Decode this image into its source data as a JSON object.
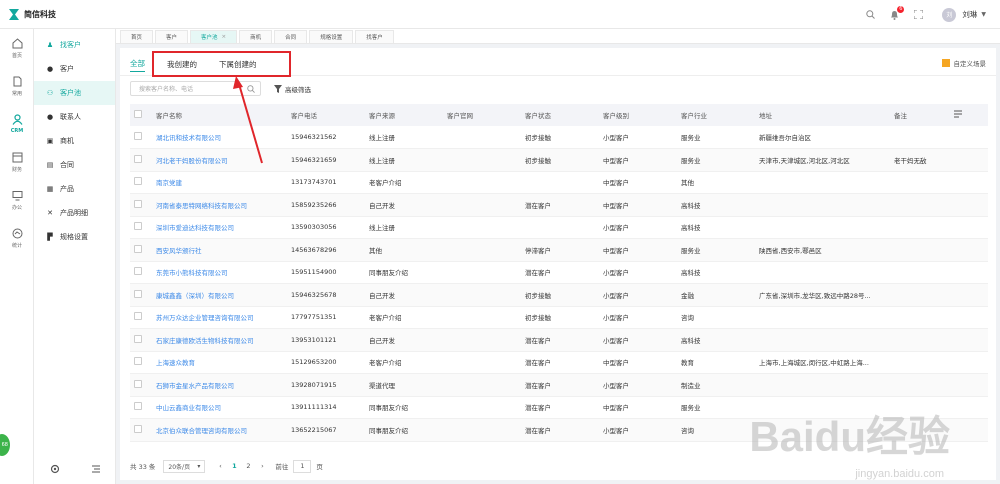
{
  "app": {
    "title": "简信科技"
  },
  "header": {
    "badge_count": "6",
    "username": "刘琳",
    "avatar_char": "刘"
  },
  "rail": [
    {
      "label": "首页",
      "icon": "home-icon"
    },
    {
      "label": "常用",
      "icon": "file-icon"
    },
    {
      "label": "CRM",
      "icon": "crm-icon",
      "active": true
    },
    {
      "label": "财务",
      "icon": "finance-icon"
    },
    {
      "label": "办公",
      "icon": "office-icon"
    },
    {
      "label": "统计",
      "icon": "stats-icon"
    }
  ],
  "subnav": [
    {
      "label": "找客户",
      "icon": "find-customer-icon",
      "current": true
    },
    {
      "label": "客户",
      "icon": "customer-icon"
    },
    {
      "label": "客户池",
      "icon": "customer-pool-icon",
      "active": true
    },
    {
      "label": "联系人",
      "icon": "contact-icon"
    },
    {
      "label": "商机",
      "icon": "opportunity-icon"
    },
    {
      "label": "合同",
      "icon": "contract-icon"
    },
    {
      "label": "产品",
      "icon": "product-icon"
    },
    {
      "label": "产品明细",
      "icon": "product-detail-icon"
    },
    {
      "label": "规格设置",
      "icon": "spec-settings-icon"
    }
  ],
  "tabs": [
    {
      "label": "首页"
    },
    {
      "label": "客户"
    },
    {
      "label": "客户池",
      "active": true,
      "close": "×"
    },
    {
      "label": "商机"
    },
    {
      "label": "合同"
    },
    {
      "label": "规格设置"
    },
    {
      "label": "找客户"
    }
  ],
  "filter": {
    "all": "全部",
    "mine": "我创建的",
    "subordinate": "下属创建的",
    "custom_scene": "自定义场景",
    "search_placeholder": "搜索客户名称、电话",
    "advanced": "高级筛选"
  },
  "table": {
    "columns": [
      "客户名称",
      "客户电话",
      "客户来源",
      "客户官网",
      "客户状态",
      "客户级别",
      "客户行业",
      "地址",
      "备注"
    ],
    "rows": [
      [
        "湖北讯和技术有限公司",
        "15946321562",
        "线上注册",
        "",
        "初步接触",
        "小型客户",
        "服务业",
        "新疆维吾尔自治区",
        ""
      ],
      [
        "河北老干妈股份有限公司",
        "15946321659",
        "线上注册",
        "",
        "初步接触",
        "中型客户",
        "服务业",
        "天津市,天津城区,河北区,河北区",
        "老干妈无敌"
      ],
      [
        "南京党建",
        "13173743701",
        "老客户介绍",
        "",
        "",
        "中型客户",
        "其他",
        "",
        ""
      ],
      [
        "河南省泰思特网络科技有限公司",
        "15859235266",
        "自己开发",
        "",
        "潜在客户",
        "中型客户",
        "高科技",
        "",
        ""
      ],
      [
        "深圳市爱迪达科技有限公司",
        "13590303056",
        "线上注册",
        "",
        "",
        "小型客户",
        "高科技",
        "",
        ""
      ],
      [
        "西安风华颁行社",
        "14563678296",
        "其他",
        "",
        "停滞客户",
        "中型客户",
        "服务业",
        "陕西省,西安市,鄠邑区",
        ""
      ],
      [
        "东莞市小熊科技有限公司",
        "15951154900",
        "同事朋友介绍",
        "",
        "潜在客户",
        "小型客户",
        "高科技",
        "",
        ""
      ],
      [
        "康城鑫鑫（深圳）有限公司",
        "15946325678",
        "自己开发",
        "",
        "初步接触",
        "小型客户",
        "金融",
        "广东省,深圳市,龙华区,致远中路28号...",
        ""
      ],
      [
        "苏州万众达企业管理咨询有限公司",
        "17797751351",
        "老客户介绍",
        "",
        "初步接触",
        "小型客户",
        "咨询",
        "",
        ""
      ],
      [
        "石家庄康德欧活生物科技有限公司",
        "13953101121",
        "自己开发",
        "",
        "潜在客户",
        "小型客户",
        "高科技",
        "",
        ""
      ],
      [
        "上海速众教育",
        "15129653200",
        "老客户介绍",
        "",
        "潜在客户",
        "中型客户",
        "教育",
        "上海市,上海城区,闵行区,中虹路上海...",
        ""
      ],
      [
        "石狮市金星水产品有限公司",
        "13928071915",
        "渠道代理",
        "",
        "潜在客户",
        "小型客户",
        "制造业",
        "",
        ""
      ],
      [
        "中山云鑫商业有限公司",
        "13911111314",
        "同事朋友介绍",
        "",
        "潜在客户",
        "中型客户",
        "服务业",
        "",
        ""
      ],
      [
        "北京伯众联合管理咨询有限公司",
        "13652215067",
        "同事朋友介绍",
        "",
        "潜在客户",
        "小型客户",
        "咨询",
        "",
        ""
      ]
    ]
  },
  "pager": {
    "total": "共 33 条",
    "page_size": "20条/页",
    "prev": "‹",
    "next": "›",
    "pages": [
      "1",
      "2"
    ],
    "goto_label": "前往",
    "goto_value": "1",
    "page_suffix": "页"
  },
  "float_button": "68",
  "watermark": {
    "main": "Baidu经验",
    "sub": "jingyan.baidu.com"
  }
}
